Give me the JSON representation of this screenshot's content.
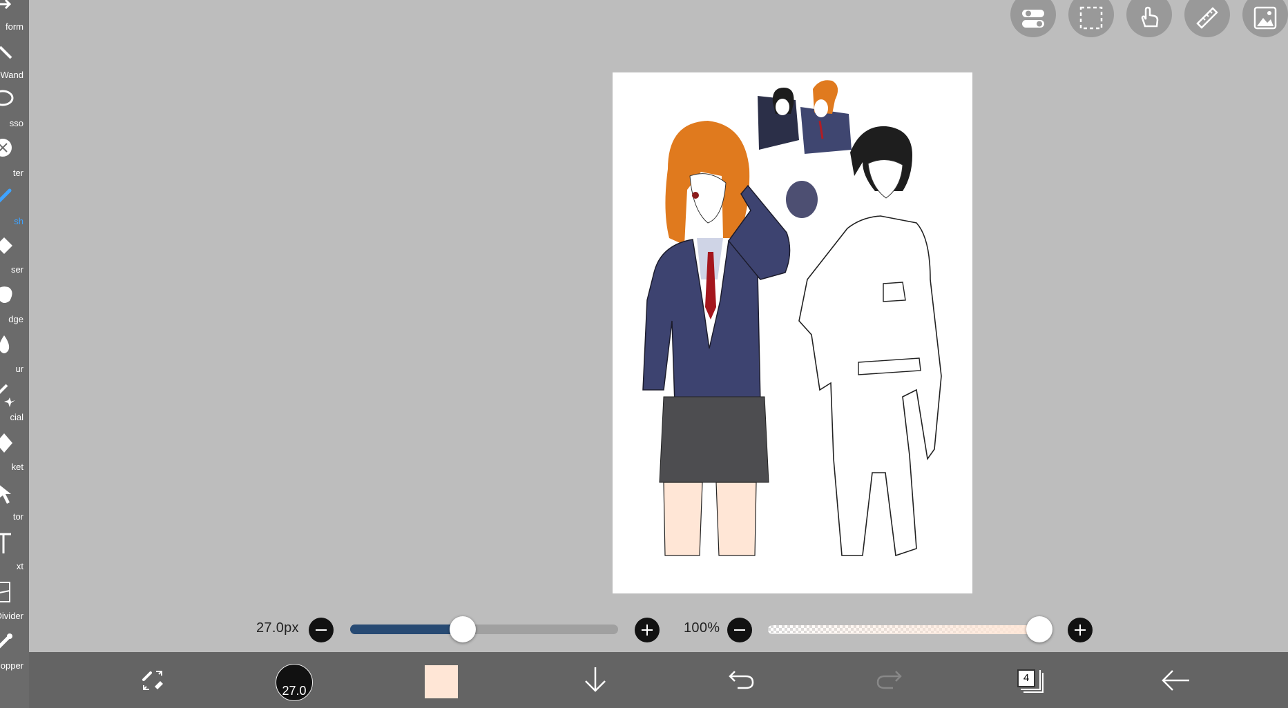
{
  "left_toolbar": {
    "tools": [
      {
        "label": "form",
        "icon": "transform-icon"
      },
      {
        "label": "Wand",
        "icon": "magic-wand-icon"
      },
      {
        "label": "sso",
        "icon": "lasso-icon"
      },
      {
        "label": "ter",
        "icon": "filter-icon"
      },
      {
        "label": "sh",
        "icon": "brush-icon",
        "active": true
      },
      {
        "label": "ser",
        "icon": "eraser-icon"
      },
      {
        "label": "dge",
        "icon": "smudge-icon"
      },
      {
        "label": "ur",
        "icon": "blur-icon"
      },
      {
        "label": "cial",
        "icon": "special-icon"
      },
      {
        "label": "ket",
        "icon": "bucket-icon"
      },
      {
        "label": "tor",
        "icon": "selector-icon"
      },
      {
        "label": "xt",
        "icon": "text-icon"
      },
      {
        "label": "Divider",
        "icon": "frame-divider-icon"
      },
      {
        "label": "opper",
        "icon": "eyedropper-icon"
      }
    ]
  },
  "top_buttons": [
    "toggle-settings-icon",
    "selection-icon",
    "hand-icon",
    "ruler-icon",
    "image-icon"
  ],
  "brush_size": {
    "value_label": "27.0px",
    "fraction": 0.42
  },
  "opacity": {
    "value_label": "100%",
    "fraction": 1.0
  },
  "bottom_bar": {
    "brush_size_label": "27.0",
    "color": "#ffe6d6",
    "layer_count": "4"
  },
  "colors": {
    "accent": "#3fa3ff",
    "slider_fill": "#274a73",
    "toolbar_bg": "#6b6b6b",
    "workspace_bg": "#bdbdbd",
    "bottom_bar_bg": "#646464"
  }
}
